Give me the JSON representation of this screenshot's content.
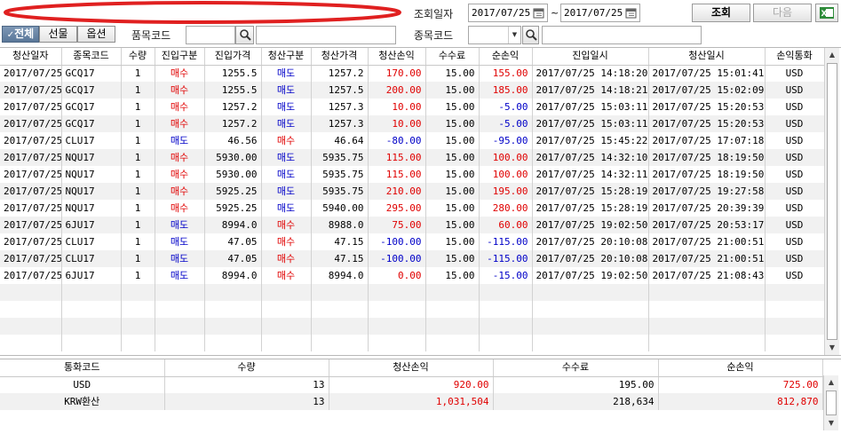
{
  "top": {
    "date_label": "조회일자",
    "date_from": "2017/07/25",
    "date_sep": "~",
    "date_to": "2017/07/25",
    "query_button": "조회",
    "next_button": "다음",
    "excel_icon": "excel-icon",
    "calendar_icon": "calendar-icon"
  },
  "filter": {
    "tab_all": "전체",
    "tab_futures": "선물",
    "tab_options": "옵션",
    "item_code_label": "품목코드",
    "item_code_value": "",
    "item_name_value": "",
    "symbol_code_label": "종목코드",
    "symbol_code_value": "",
    "symbol_name_value": "",
    "search_icon": "search-icon"
  },
  "columns": [
    "청산일자",
    "종목코드",
    "수량",
    "진입구분",
    "진입가격",
    "청산구분",
    "청산가격",
    "청산손익",
    "수수료",
    "순손익",
    "진입일시",
    "청산일시",
    "손익통화"
  ],
  "rows": [
    {
      "date": "2017/07/25",
      "code": "GCQ17",
      "qty": "1",
      "entry_side": "매수",
      "entry_price": "1255.5",
      "exit_side": "매도",
      "exit_price": "1257.2",
      "pnl": "170.00",
      "fee": "15.00",
      "net": "155.00",
      "entry_time": "2017/07/25 14:18:20",
      "exit_time": "2017/07/25 15:01:41",
      "ccy": "USD"
    },
    {
      "date": "2017/07/25",
      "code": "GCQ17",
      "qty": "1",
      "entry_side": "매수",
      "entry_price": "1255.5",
      "exit_side": "매도",
      "exit_price": "1257.5",
      "pnl": "200.00",
      "fee": "15.00",
      "net": "185.00",
      "entry_time": "2017/07/25 14:18:21",
      "exit_time": "2017/07/25 15:02:09",
      "ccy": "USD"
    },
    {
      "date": "2017/07/25",
      "code": "GCQ17",
      "qty": "1",
      "entry_side": "매수",
      "entry_price": "1257.2",
      "exit_side": "매도",
      "exit_price": "1257.3",
      "pnl": "10.00",
      "fee": "15.00",
      "net": "-5.00",
      "entry_time": "2017/07/25 15:03:11",
      "exit_time": "2017/07/25 15:20:53",
      "ccy": "USD"
    },
    {
      "date": "2017/07/25",
      "code": "GCQ17",
      "qty": "1",
      "entry_side": "매수",
      "entry_price": "1257.2",
      "exit_side": "매도",
      "exit_price": "1257.3",
      "pnl": "10.00",
      "fee": "15.00",
      "net": "-5.00",
      "entry_time": "2017/07/25 15:03:11",
      "exit_time": "2017/07/25 15:20:53",
      "ccy": "USD"
    },
    {
      "date": "2017/07/25",
      "code": "CLU17",
      "qty": "1",
      "entry_side": "매도",
      "entry_price": "46.56",
      "exit_side": "매수",
      "exit_price": "46.64",
      "pnl": "-80.00",
      "fee": "15.00",
      "net": "-95.00",
      "entry_time": "2017/07/25 15:45:22",
      "exit_time": "2017/07/25 17:07:18",
      "ccy": "USD"
    },
    {
      "date": "2017/07/25",
      "code": "NQU17",
      "qty": "1",
      "entry_side": "매수",
      "entry_price": "5930.00",
      "exit_side": "매도",
      "exit_price": "5935.75",
      "pnl": "115.00",
      "fee": "15.00",
      "net": "100.00",
      "entry_time": "2017/07/25 14:32:10",
      "exit_time": "2017/07/25 18:19:50",
      "ccy": "USD"
    },
    {
      "date": "2017/07/25",
      "code": "NQU17",
      "qty": "1",
      "entry_side": "매수",
      "entry_price": "5930.00",
      "exit_side": "매도",
      "exit_price": "5935.75",
      "pnl": "115.00",
      "fee": "15.00",
      "net": "100.00",
      "entry_time": "2017/07/25 14:32:11",
      "exit_time": "2017/07/25 18:19:50",
      "ccy": "USD"
    },
    {
      "date": "2017/07/25",
      "code": "NQU17",
      "qty": "1",
      "entry_side": "매수",
      "entry_price": "5925.25",
      "exit_side": "매도",
      "exit_price": "5935.75",
      "pnl": "210.00",
      "fee": "15.00",
      "net": "195.00",
      "entry_time": "2017/07/25 15:28:19",
      "exit_time": "2017/07/25 19:27:58",
      "ccy": "USD"
    },
    {
      "date": "2017/07/25",
      "code": "NQU17",
      "qty": "1",
      "entry_side": "매수",
      "entry_price": "5925.25",
      "exit_side": "매도",
      "exit_price": "5940.00",
      "pnl": "295.00",
      "fee": "15.00",
      "net": "280.00",
      "entry_time": "2017/07/25 15:28:19",
      "exit_time": "2017/07/25 20:39:39",
      "ccy": "USD"
    },
    {
      "date": "2017/07/25",
      "code": "6JU17",
      "qty": "1",
      "entry_side": "매도",
      "entry_price": "8994.0",
      "exit_side": "매수",
      "exit_price": "8988.0",
      "pnl": "75.00",
      "fee": "15.00",
      "net": "60.00",
      "entry_time": "2017/07/25 19:02:50",
      "exit_time": "2017/07/25 20:53:17",
      "ccy": "USD"
    },
    {
      "date": "2017/07/25",
      "code": "CLU17",
      "qty": "1",
      "entry_side": "매도",
      "entry_price": "47.05",
      "exit_side": "매수",
      "exit_price": "47.15",
      "pnl": "-100.00",
      "fee": "15.00",
      "net": "-115.00",
      "entry_time": "2017/07/25 20:10:08",
      "exit_time": "2017/07/25 21:00:51",
      "ccy": "USD"
    },
    {
      "date": "2017/07/25",
      "code": "CLU17",
      "qty": "1",
      "entry_side": "매도",
      "entry_price": "47.05",
      "exit_side": "매수",
      "exit_price": "47.15",
      "pnl": "-100.00",
      "fee": "15.00",
      "net": "-115.00",
      "entry_time": "2017/07/25 20:10:08",
      "exit_time": "2017/07/25 21:00:51",
      "ccy": "USD"
    },
    {
      "date": "2017/07/25",
      "code": "6JU17",
      "qty": "1",
      "entry_side": "매도",
      "entry_price": "8994.0",
      "exit_side": "매수",
      "exit_price": "8994.0",
      "pnl": "0.00",
      "fee": "15.00",
      "net": "-15.00",
      "entry_time": "2017/07/25 19:02:50",
      "exit_time": "2017/07/25 21:08:43",
      "ccy": "USD"
    }
  ],
  "summary": {
    "columns": [
      "통화코드",
      "수량",
      "청산손익",
      "수수료",
      "순손익"
    ],
    "rows": [
      {
        "ccy": "USD",
        "qty": "13",
        "pnl": "920.00",
        "fee": "195.00",
        "net": "725.00"
      },
      {
        "ccy": "KRW환산",
        "qty": "13",
        "pnl": "1,031,504",
        "fee": "218,634",
        "net": "812,870"
      }
    ]
  },
  "colors": {
    "buy": "#e00000",
    "sell": "#0000c8",
    "positive": "#e00000",
    "negative": "#0000c8",
    "highlight_circle": "#e02020"
  }
}
